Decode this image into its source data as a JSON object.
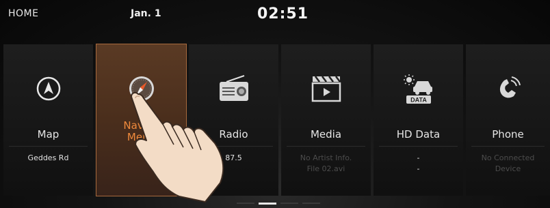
{
  "status_bar": {
    "home_label": "HOME",
    "date": "Jan. 1",
    "time": "02:51"
  },
  "tiles": [
    {
      "label": "Map",
      "sub": [
        "Geddes Rd"
      ],
      "icon": "navigation-arrow-icon"
    },
    {
      "label": "Navigation Menu",
      "label_lines": [
        "Naviga",
        "Menu"
      ],
      "sub": [],
      "icon": "compass-icon",
      "selected": true
    },
    {
      "label": "Radio",
      "sub": [
        "87.5"
      ],
      "icon": "radio-icon"
    },
    {
      "label": "Media",
      "sub": [
        "No Artist Info.",
        "File 02.avi"
      ],
      "icon": "media-clapperboard-icon"
    },
    {
      "label": "HD Data",
      "sub": [
        "-",
        "-"
      ],
      "icon": "hd-data-icon"
    },
    {
      "label": "Phone",
      "sub": [
        "No Connected",
        "Device"
      ],
      "icon": "phone-icon"
    }
  ],
  "colors": {
    "selected_label": "#f08a3c",
    "selected_tile": "#4a2e1c"
  },
  "pager": {
    "pages": 4,
    "active_page": 2
  }
}
